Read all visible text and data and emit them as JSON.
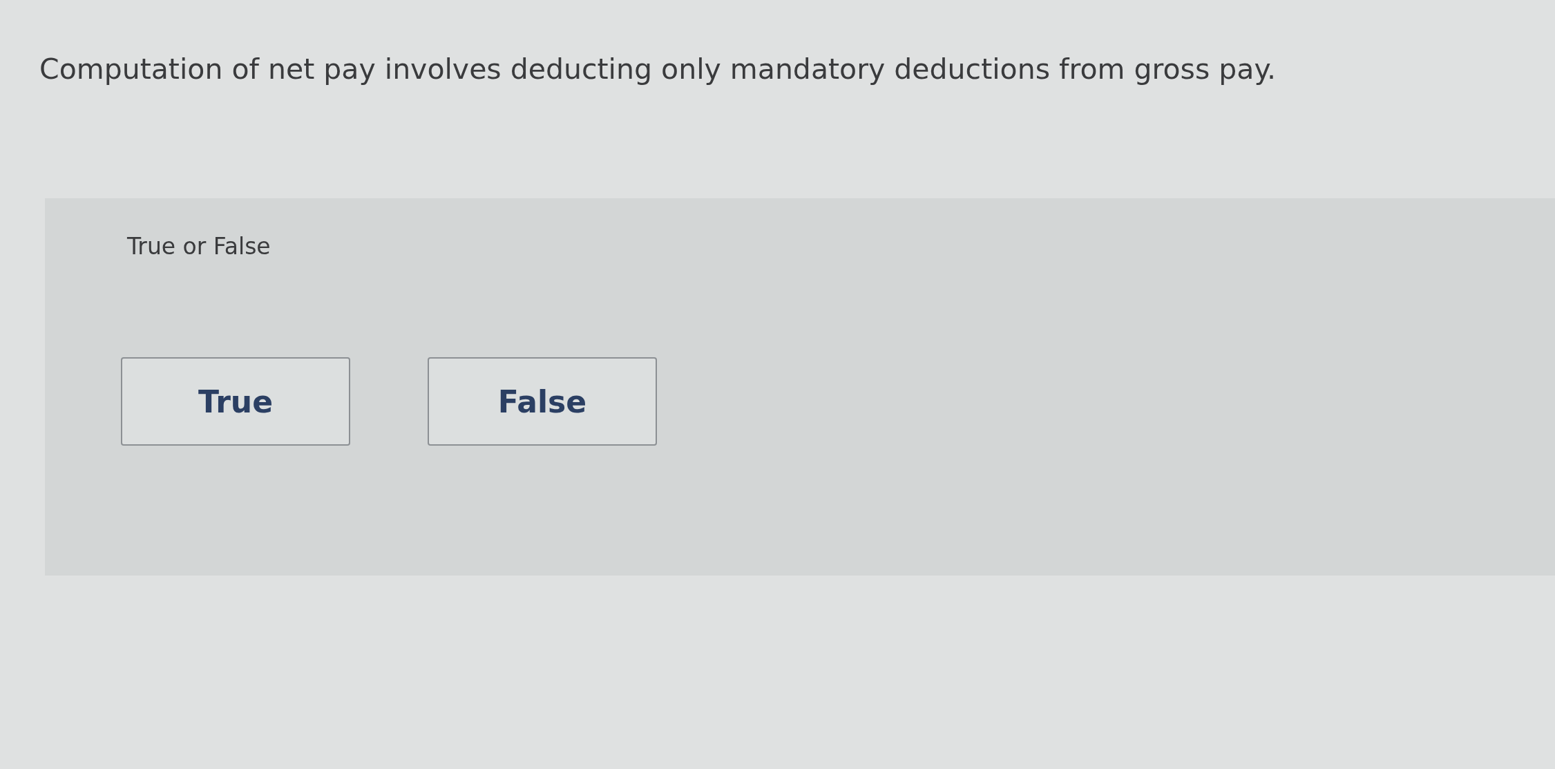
{
  "question": {
    "text": "Computation of net pay involves deducting only mandatory deductions from gross pay."
  },
  "answer_panel": {
    "prompt": "True or False",
    "options": [
      {
        "label": "True",
        "selected": false
      },
      {
        "label": "False",
        "selected": false
      }
    ]
  }
}
